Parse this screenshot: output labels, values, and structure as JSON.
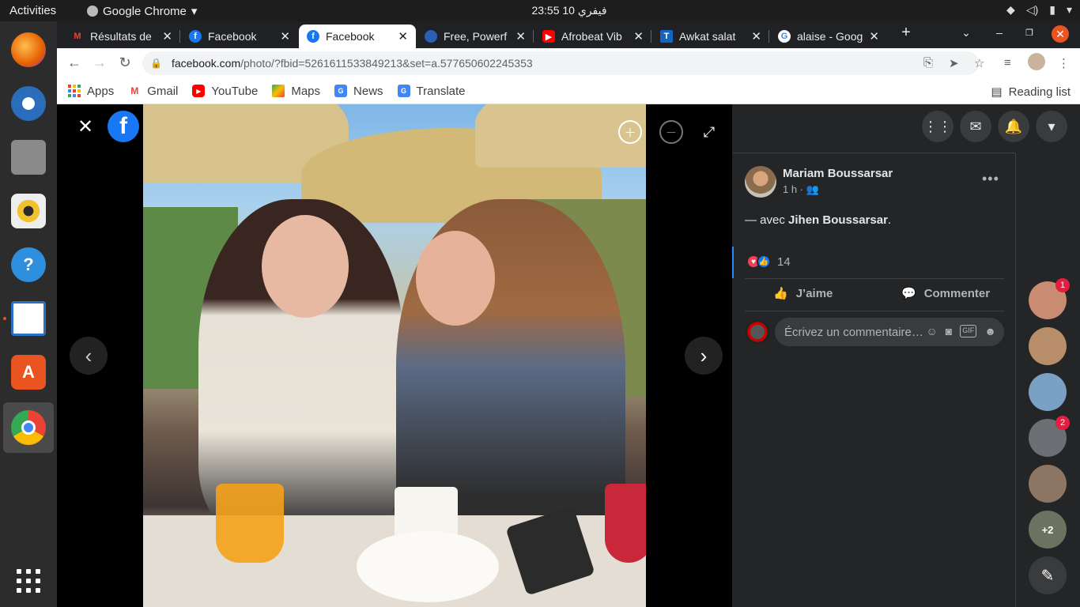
{
  "topbar": {
    "activities": "Activities",
    "app_name": "Google Chrome",
    "clock": "فيفري 10  23:55"
  },
  "dock": {
    "items": [
      {
        "name": "firefox",
        "color": "#e66000"
      },
      {
        "name": "thunderbird",
        "color": "#2a6ebb"
      },
      {
        "name": "files",
        "color": "#9a9a9a"
      },
      {
        "name": "rhythmbox",
        "color": "#f2c12e"
      },
      {
        "name": "help",
        "color": "#2d8fde"
      },
      {
        "name": "libreoffice-writer",
        "color": "#2a72c4"
      },
      {
        "name": "software",
        "color": "#e95420"
      },
      {
        "name": "chrome",
        "color": "#4285f4"
      }
    ]
  },
  "tabs": [
    {
      "title": "Résultats de",
      "favicon": "gmail-icon",
      "color": "#ea4335"
    },
    {
      "title": "Facebook",
      "favicon": "facebook-icon",
      "color": "#1877f2"
    },
    {
      "title": "Facebook",
      "favicon": "facebook-icon",
      "color": "#1877f2"
    },
    {
      "title": "Free, Powerf",
      "favicon": "globe-icon",
      "color": "#2b5fb5"
    },
    {
      "title": "Afrobeat Vib",
      "favicon": "youtube-icon",
      "color": "#ff0000"
    },
    {
      "title": "Awkat salat",
      "favicon": "t-icon",
      "color": "#1565c0"
    },
    {
      "title": "alaise - Goog",
      "favicon": "google-icon",
      "color": "#4285f4"
    }
  ],
  "address": {
    "host": "facebook.com",
    "path": "/photo/?fbid=5261611533849213&set=a.577650602245353"
  },
  "bookmarks": [
    {
      "label": "Apps",
      "icon": "apps-grid-icon",
      "color": "#ea4335"
    },
    {
      "label": "Gmail",
      "icon": "gmail-icon",
      "color": "#ea4335"
    },
    {
      "label": "YouTube",
      "icon": "youtube-icon",
      "color": "#ff0000"
    },
    {
      "label": "Maps",
      "icon": "maps-icon",
      "color": "#34a853"
    },
    {
      "label": "News",
      "icon": "news-icon",
      "color": "#4285f4"
    },
    {
      "label": "Translate",
      "icon": "translate-icon",
      "color": "#4285f4"
    }
  ],
  "reading_list": "Reading list",
  "post": {
    "author": "Mariam Boussarsar",
    "time": "1 h ·",
    "text_prefix": "— avec ",
    "tagged": "Jihen Boussarsar",
    "text_suffix": ".",
    "reaction_count": "14",
    "like_label": "J’aime",
    "comment_label": "Commenter",
    "comment_placeholder": "Écrivez un commentaire…"
  },
  "contacts": [
    {
      "badge": "1",
      "color": "#c98b72"
    },
    {
      "badge": "",
      "color": "#b88d6a"
    },
    {
      "badge": "",
      "color": "#7aa0c4"
    },
    {
      "badge": "2",
      "color": "#6b6f73"
    },
    {
      "badge": "",
      "color": "#8c7563"
    },
    {
      "badge": "",
      "label": "+2",
      "color": "#6d7160"
    }
  ],
  "colors": {
    "fb_blue": "#1877f2",
    "panel_bg": "#242526",
    "badge_red": "#e41e3f"
  }
}
